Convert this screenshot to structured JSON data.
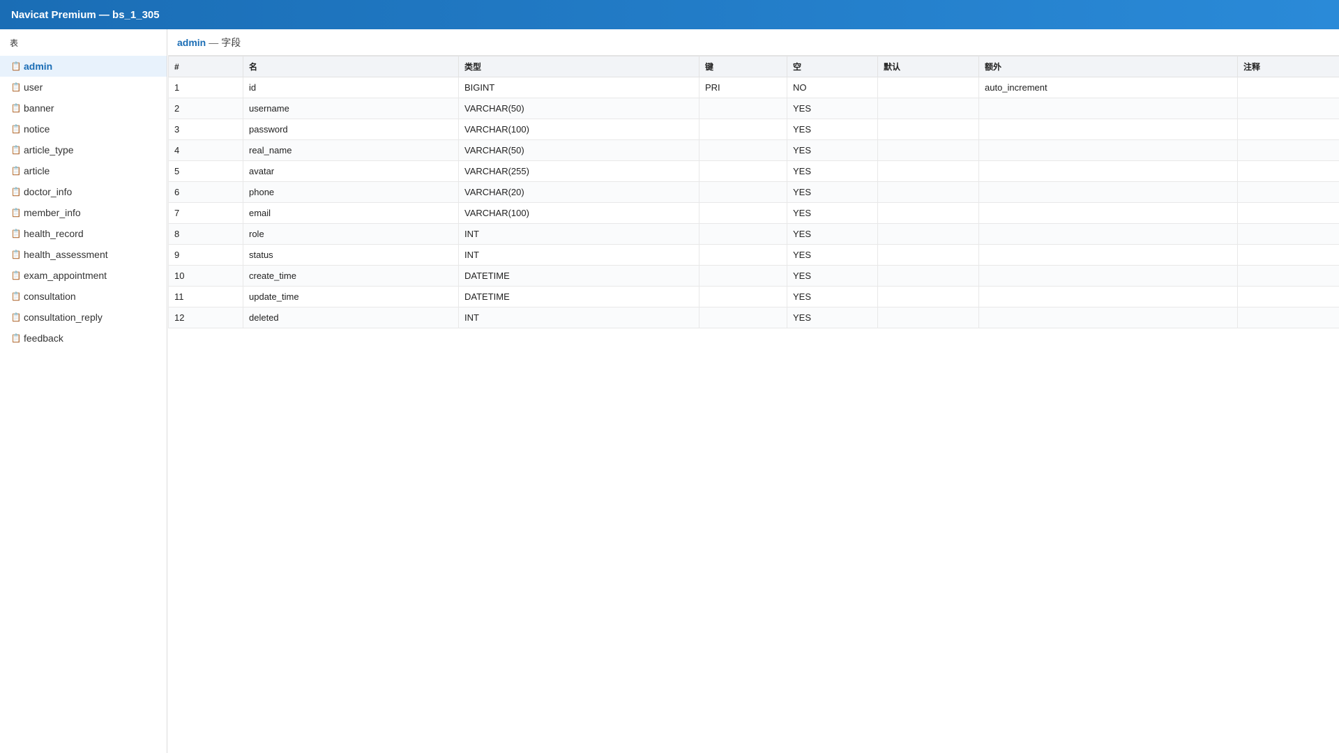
{
  "window": {
    "title": "Navicat Premium — bs_1_305"
  },
  "sidebar": {
    "header": "表",
    "items": [
      {
        "label": "admin",
        "icon": "table-icon",
        "active": true
      },
      {
        "label": "user",
        "icon": "table-icon"
      },
      {
        "label": "banner",
        "icon": "table-icon"
      },
      {
        "label": "notice",
        "icon": "table-icon"
      },
      {
        "label": "article_type",
        "icon": "table-icon"
      },
      {
        "label": "article",
        "icon": "table-icon"
      },
      {
        "label": "doctor_info",
        "icon": "table-icon"
      },
      {
        "label": "member_info",
        "icon": "table-icon"
      },
      {
        "label": "health_record",
        "icon": "table-icon"
      },
      {
        "label": "health_assessment",
        "icon": "table-icon"
      },
      {
        "label": "exam_appointment",
        "icon": "table-icon"
      },
      {
        "label": "consultation",
        "icon": "table-icon"
      },
      {
        "label": "consultation_reply",
        "icon": "table-icon"
      },
      {
        "label": "feedback",
        "icon": "table-icon"
      }
    ]
  },
  "breadcrumb": {
    "table": "admin",
    "separator": "—",
    "section": "字段"
  },
  "table": {
    "columns": [
      "#",
      "名",
      "类型",
      "键",
      "空",
      "默认",
      "额外",
      "注释"
    ],
    "rows": [
      [
        "1",
        "id",
        "BIGINT",
        "PRI",
        "NO",
        "",
        "auto_increment",
        ""
      ],
      [
        "2",
        "username",
        "VARCHAR(50)",
        "",
        "YES",
        "",
        "",
        ""
      ],
      [
        "3",
        "password",
        "VARCHAR(100)",
        "",
        "YES",
        "",
        "",
        ""
      ],
      [
        "4",
        "real_name",
        "VARCHAR(50)",
        "",
        "YES",
        "",
        "",
        ""
      ],
      [
        "5",
        "avatar",
        "VARCHAR(255)",
        "",
        "YES",
        "",
        "",
        ""
      ],
      [
        "6",
        "phone",
        "VARCHAR(20)",
        "",
        "YES",
        "",
        "",
        ""
      ],
      [
        "7",
        "email",
        "VARCHAR(100)",
        "",
        "YES",
        "",
        "",
        ""
      ],
      [
        "8",
        "role",
        "INT",
        "",
        "YES",
        "",
        "",
        ""
      ],
      [
        "9",
        "status",
        "INT",
        "",
        "YES",
        "",
        "",
        ""
      ],
      [
        "10",
        "create_time",
        "DATETIME",
        "",
        "YES",
        "",
        "",
        ""
      ],
      [
        "11",
        "update_time",
        "DATETIME",
        "",
        "YES",
        "",
        "",
        ""
      ],
      [
        "12",
        "deleted",
        "INT",
        "",
        "YES",
        "",
        "",
        ""
      ]
    ]
  },
  "colors": {
    "titlebar_start": "#1a6db5",
    "titlebar_end": "#2a8ad8",
    "accent": "#1a6db5",
    "active_row_bg": "#e8f2fc",
    "icon_color": "#d9a441"
  }
}
